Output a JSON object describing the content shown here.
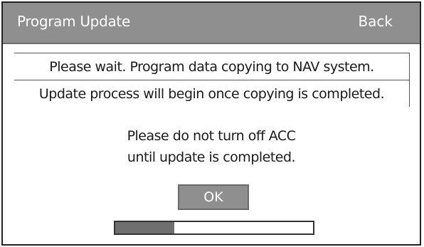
{
  "header": {
    "title": "Program Update",
    "back_label": "Back"
  },
  "messages": {
    "line1": "Please wait. Program data copying to NAV system.",
    "line2": "Update process will begin once copying is completed."
  },
  "warning": {
    "line1": "Please do not turn off ACC",
    "line2": "until update is completed."
  },
  "buttons": {
    "ok_label": "OK"
  },
  "progress": {
    "fraction": 0.3
  },
  "colors": {
    "titlebar": "#8f8f8f",
    "progress_fill": "#6f6f6f"
  }
}
